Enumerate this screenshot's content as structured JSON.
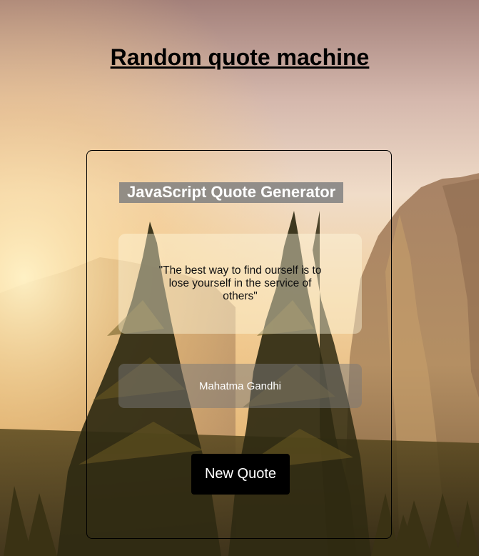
{
  "page": {
    "title": "Random quote machine"
  },
  "card": {
    "title": "JavaScript Quote Generator",
    "quote": "\"The best way to find ourself is to lose yourself in the service of others\"",
    "author": "Mahatma Gandhi",
    "button_label": "New Quote"
  },
  "background": {
    "image": "mountain-forest-sunset-photo",
    "colors": {
      "sky_top": "#a6837a",
      "sky_glow": "#f4d7a8",
      "cliff": "#9c7a5a",
      "trees": "#2e2a10"
    }
  }
}
